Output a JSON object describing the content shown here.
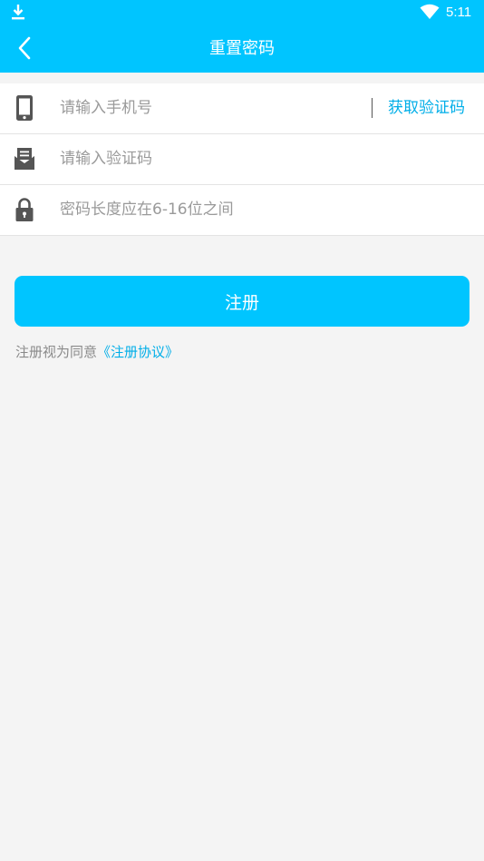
{
  "status_bar": {
    "time": "5:11",
    "download_icon": "download-icon",
    "wifi_icon": "wifi-icon"
  },
  "header": {
    "title": "重置密码",
    "back_icon": "chevron-left-icon"
  },
  "form": {
    "phone": {
      "placeholder": "请输入手机号",
      "value": "",
      "icon": "phone-icon"
    },
    "get_code_label": "获取验证码",
    "code": {
      "placeholder": "请输入验证码",
      "value": "",
      "icon": "mail-icon"
    },
    "password": {
      "placeholder": "密码长度应在6-16位之间",
      "value": "",
      "icon": "lock-icon"
    }
  },
  "register_button": {
    "label": "注册"
  },
  "agreement": {
    "prefix": "注册视为同意",
    "link": "《注册协议》"
  },
  "colors": {
    "accent": "#00c5ff",
    "link": "#00aee8",
    "background": "#f4f4f4",
    "placeholder": "#9a9a9a",
    "icon": "#555555"
  }
}
